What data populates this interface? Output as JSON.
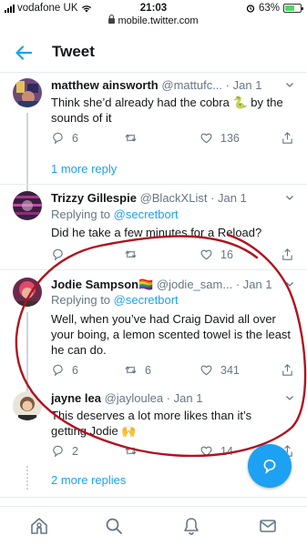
{
  "status_bar": {
    "carrier": "vodafone UK",
    "time": "21:03",
    "battery": "63%",
    "battery_level": 0.63
  },
  "url_bar": {
    "url": "mobile.twitter.com"
  },
  "header": {
    "title": "Tweet"
  },
  "colors": {
    "accent": "#1da1f2",
    "muted": "#657786",
    "annotation": "#b0121f"
  },
  "tweets": [
    {
      "name": "matthew ainsworth",
      "handle": "@mattufc...",
      "time": "Jan 1",
      "text": "Think she’d already had the cobra 🐍 by the sounds of it",
      "replies": "6",
      "retweets": "",
      "likes": "136"
    },
    {
      "name": "Trizzy Gillespie",
      "handle": "@BlackXList",
      "time": "Jan 1",
      "replying_label": "Replying to",
      "replying_to": "@secretbort",
      "text": "Did he take a few minutes for a Reload?",
      "replies": "",
      "retweets": "",
      "likes": "16"
    },
    {
      "name": "Jodie Sampson🏳️‍🌈",
      "handle": "@jodie_sam...",
      "time": "Jan 1",
      "replying_label": "Replying to",
      "replying_to": "@secretbort",
      "text": "Well, when you’ve had Craig David all over your boing, a lemon scented towel is the least he can do.",
      "replies": "6",
      "retweets": "6",
      "likes": "341"
    },
    {
      "name": "jayne lea",
      "handle": "@jayloulea",
      "time": "Jan 1",
      "text": "This deserves a lot more likes than it’s getting Jodie 🙌",
      "replies": "2",
      "retweets": "",
      "likes": "14"
    }
  ],
  "more_replies_1": "1 more reply",
  "more_replies_2": "2 more replies",
  "tabbar": {
    "icons": [
      "home-icon",
      "search-icon",
      "notifications-icon",
      "messages-icon"
    ]
  }
}
